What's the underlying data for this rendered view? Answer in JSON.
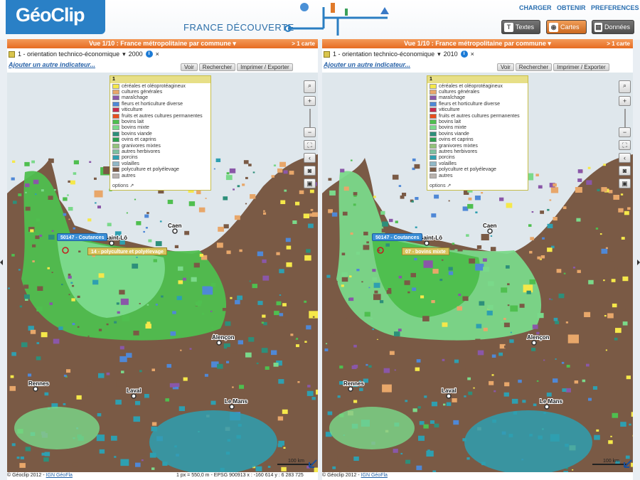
{
  "app": {
    "logo": "GéoClip",
    "subtitle": "FRANCE DÉCOUVERTE"
  },
  "nav": {
    "charger": "CHARGER",
    "obtenir": "OBTENIR",
    "preferences": "PREFERENCES"
  },
  "view_buttons": {
    "textes": "Textes",
    "cartes": "Cartes",
    "donnees": "Données",
    "active": "Cartes"
  },
  "panels": [
    {
      "title": "Vue 1/10 : France métropolitaine par commune",
      "count": "> 1 carte",
      "indicator": "1 - orientation technico-économique",
      "year": "2000",
      "add": "Ajouter un autre indicateur...",
      "menu": [
        "Voir",
        "Rechercher",
        "Imprimer / Exporter"
      ],
      "commune": "50147 - Coutances",
      "value": "14 - polyculture et polyélevage",
      "scale": "100 km",
      "footer": "© Géoclip 2012 - ",
      "footer_link": "IGN GéoFla",
      "coords": "1 px = 550,0 m - EPSG 900913 x : -160 614 y : 6 283 725"
    },
    {
      "title": "Vue 1/10 : France métropolitaine par commune",
      "count": "> 1 carte",
      "indicator": "1 - orientation technico-économique",
      "year": "2010",
      "add": "Ajouter un autre indicateur...",
      "menu": [
        "Voir",
        "Rechercher",
        "Imprimer / Exporter"
      ],
      "commune": "50147 - Coutances",
      "value": "07 - bovins mixte",
      "scale": "100 km",
      "footer": "© Géoclip 2012 - ",
      "footer_link": "IGN GéoFla",
      "coords": ""
    }
  ],
  "legend": {
    "header": "1",
    "options": "options",
    "items": [
      {
        "label": "céréales et oléoprotéagineux",
        "color": "#f5e84a"
      },
      {
        "label": "cultures générales",
        "color": "#e8a76a"
      },
      {
        "label": "maraîchage",
        "color": "#8a57a8"
      },
      {
        "label": "fleurs et horticulture diverse",
        "color": "#4f88d6"
      },
      {
        "label": "viticulture",
        "color": "#c72b4e"
      },
      {
        "label": "fruits et autres cultures permanentes",
        "color": "#e84e1e"
      },
      {
        "label": "bovins lait",
        "color": "#4fbf4f"
      },
      {
        "label": "bovins mixte",
        "color": "#7ad98a"
      },
      {
        "label": "bovins viande",
        "color": "#2d8f7a"
      },
      {
        "label": "ovins et caprins",
        "color": "#2ea050"
      },
      {
        "label": "granivores mixtes",
        "color": "#93c27a"
      },
      {
        "label": "autres herbivores",
        "color": "#7dc0a0"
      },
      {
        "label": "porcins",
        "color": "#2e9fb0"
      },
      {
        "label": "volailles",
        "color": "#8fb8c7"
      },
      {
        "label": "polyculture et polyélevage",
        "color": "#7a5a45"
      },
      {
        "label": "autres",
        "color": "#b9b2ad"
      }
    ]
  },
  "cities": [
    "Caen",
    "Saint-Lô",
    "Alençon",
    "Rennes",
    "Laval",
    "Le Mans"
  ]
}
